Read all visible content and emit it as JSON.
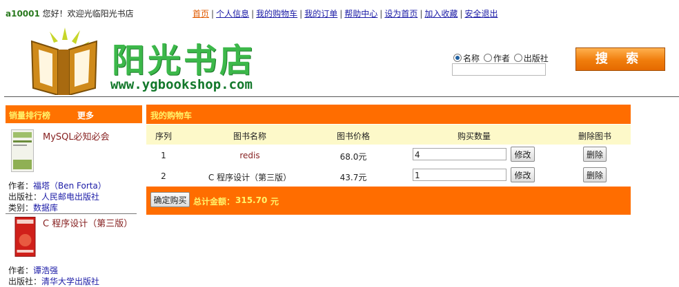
{
  "topbar": {
    "user_id": "a10001",
    "greeting": " 您好！欢迎光临阳光书店",
    "nav": [
      {
        "label": "首页",
        "active": true
      },
      {
        "label": "个人信息"
      },
      {
        "label": "我的购物车"
      },
      {
        "label": "我的订单"
      },
      {
        "label": "帮助中心"
      },
      {
        "label": "设为首页"
      },
      {
        "label": "加入收藏"
      },
      {
        "label": "安全退出"
      }
    ]
  },
  "logo": {
    "title": "阳光书店",
    "url": "www.ygbookshop.com"
  },
  "search": {
    "options": [
      "名称",
      "作者",
      "出版社"
    ],
    "selected": "名称",
    "value": "",
    "button_label": "搜 索"
  },
  "sidebar": {
    "title": "销量排行榜",
    "more_label": "更多",
    "books": [
      {
        "title": "MySQL必知必会",
        "author_label": "作者：",
        "author": "福塔（Ben Forta）",
        "publisher_label": "出版社：",
        "publisher": "人民邮电出版社",
        "category_label": "类别：",
        "category": "数据库"
      },
      {
        "title": "C 程序设计（第三版）",
        "author_label": "作者：",
        "author": "谭浩强",
        "publisher_label": "出版社：",
        "publisher": "清华大学出版社"
      }
    ]
  },
  "cart": {
    "title": "我的购物车",
    "columns": [
      "序列",
      "图书名称",
      "图书价格",
      "购买数量",
      "删除图书"
    ],
    "rows": [
      {
        "index": "1",
        "name": "redis",
        "price": "68.0元",
        "qty": "4",
        "modify_label": "修改",
        "delete_label": "删除"
      },
      {
        "index": "2",
        "name": "C 程序设计（第三版）",
        "price": "43.7元",
        "qty": "1",
        "modify_label": "修改",
        "delete_label": "删除"
      }
    ],
    "confirm_label": "确定购买",
    "total_label": "总计金额：",
    "total_value": "315.70",
    "total_unit": "元"
  },
  "colors": {
    "orange": "#ff6d00",
    "header_text": "#fff36a",
    "column_bg": "#fdf9c9",
    "link": "#1a1aa6",
    "brand_green": "#3cb84a"
  }
}
